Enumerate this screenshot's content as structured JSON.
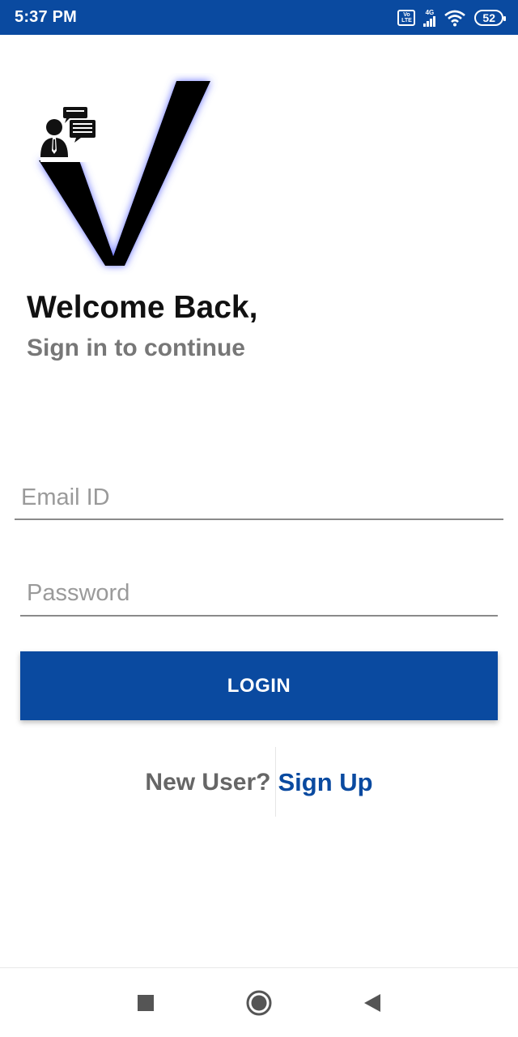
{
  "status_bar": {
    "time": "5:37 PM",
    "volte_top": "Vo",
    "volte_bottom": "LTE",
    "network": "4G",
    "battery": "52"
  },
  "header": {
    "welcome": "Welcome Back,",
    "subtitle": "Sign in to continue"
  },
  "form": {
    "email_placeholder": "Email ID",
    "email_value": "",
    "password_placeholder": "Password",
    "password_value": "",
    "login_label": "LOGIN"
  },
  "footer": {
    "new_user_text": "New User?",
    "signup_label": "Sign Up"
  },
  "colors": {
    "primary": "#0a4aa0",
    "muted_text": "#777777"
  },
  "icons": {
    "logo": "v-logo-icon",
    "badge": "person-chat-icon",
    "nav_recent": "square-icon",
    "nav_home": "circle-icon",
    "nav_back": "triangle-back-icon"
  }
}
